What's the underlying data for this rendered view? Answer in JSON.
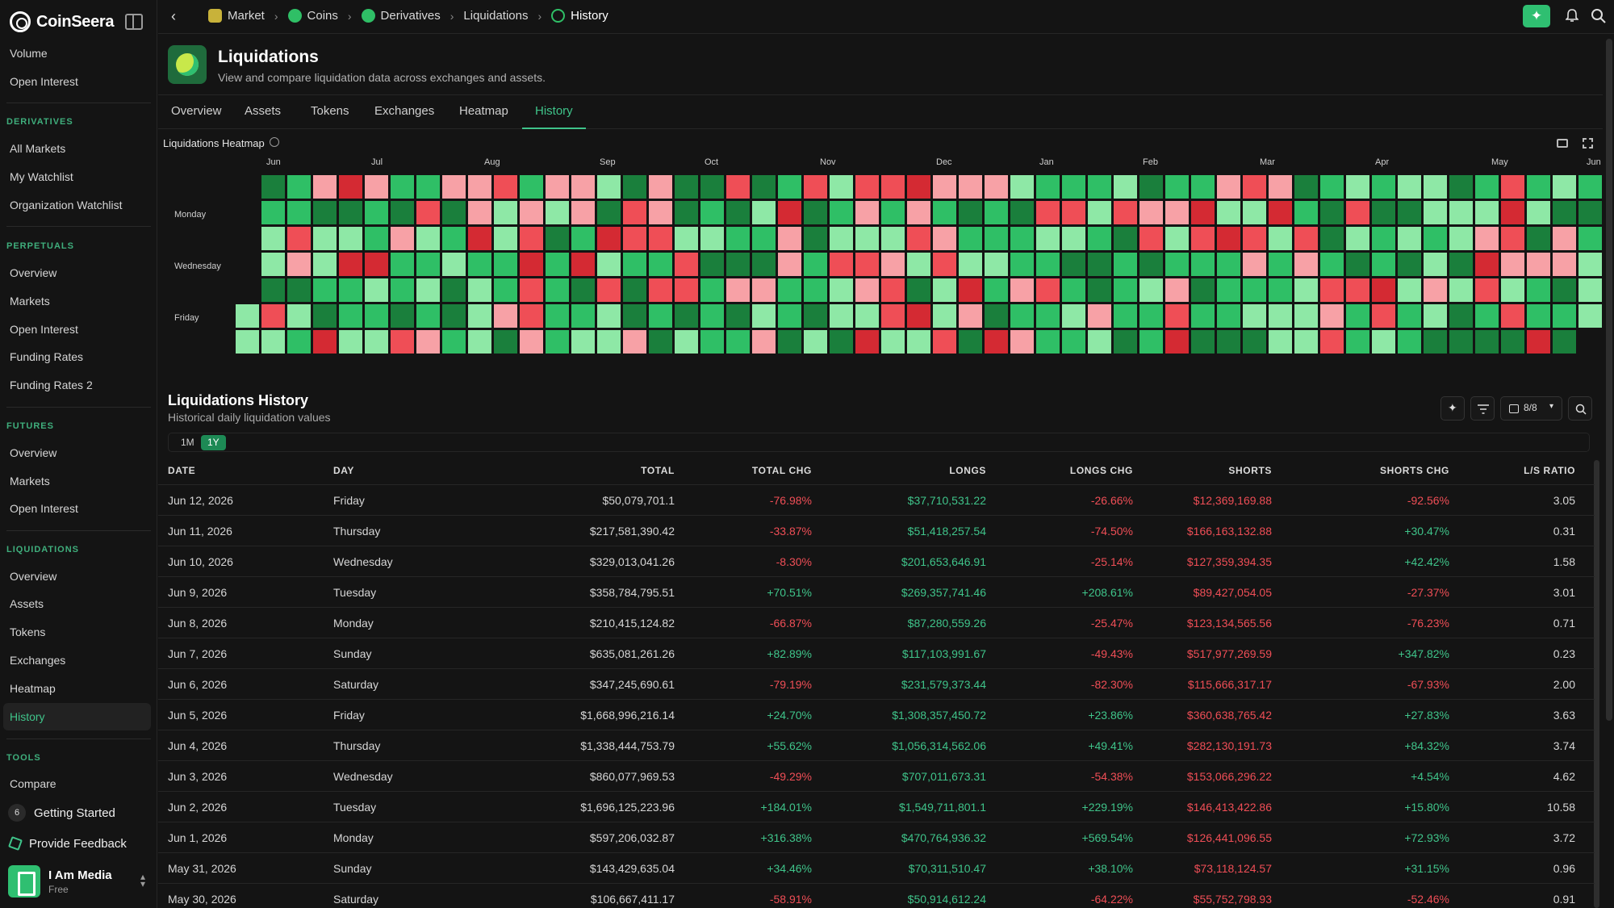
{
  "app": {
    "name": "CoinSeera"
  },
  "sidebar": {
    "top_items": [
      {
        "label": "Volume"
      },
      {
        "label": "Open Interest"
      }
    ],
    "sections": [
      {
        "title": "DERIVATIVES",
        "items": [
          {
            "label": "All Markets"
          },
          {
            "label": "My Watchlist"
          },
          {
            "label": "Organization Watchlist"
          }
        ]
      },
      {
        "title": "PERPETUALS",
        "items": [
          {
            "label": "Overview"
          },
          {
            "label": "Markets"
          },
          {
            "label": "Open Interest"
          },
          {
            "label": "Funding Rates"
          },
          {
            "label": "Funding Rates 2"
          }
        ]
      },
      {
        "title": "FUTURES",
        "items": [
          {
            "label": "Overview"
          },
          {
            "label": "Markets"
          },
          {
            "label": "Open Interest"
          }
        ]
      },
      {
        "title": "LIQUIDATIONS",
        "items": [
          {
            "label": "Overview"
          },
          {
            "label": "Assets"
          },
          {
            "label": "Tokens"
          },
          {
            "label": "Exchanges"
          },
          {
            "label": "Heatmap"
          },
          {
            "label": "History",
            "active": true
          }
        ]
      },
      {
        "title": "TOOLS",
        "items": [
          {
            "label": "Compare"
          }
        ]
      }
    ],
    "getting_started": {
      "label": "Getting Started",
      "badge": "6"
    },
    "feedback": {
      "label": "Provide Feedback"
    },
    "user": {
      "name": "I Am Media",
      "plan": "Free"
    }
  },
  "breadcrumbs": [
    {
      "label": "Market",
      "icon": "market-icon"
    },
    {
      "label": "Coins",
      "icon": "coins-icon"
    },
    {
      "label": "Derivatives",
      "icon": "derivatives-icon"
    },
    {
      "label": "Liquidations",
      "icon": ""
    },
    {
      "label": "History",
      "icon": "history-icon"
    }
  ],
  "page": {
    "title": "Liquidations",
    "subtitle": "View and compare liquidation data across exchanges and assets.",
    "tabs": [
      {
        "label": "Overview"
      },
      {
        "label": "Assets"
      },
      {
        "label": "Tokens"
      },
      {
        "label": "Exchanges"
      },
      {
        "label": "Heatmap"
      },
      {
        "label": "History",
        "active": true
      }
    ]
  },
  "heatmap": {
    "title": "Liquidations Heatmap",
    "months": [
      "Jun",
      "Jul",
      "Aug",
      "Sep",
      "Oct",
      "Nov",
      "Dec",
      "Jan",
      "Feb",
      "Mar",
      "Apr",
      "May",
      "Jun"
    ],
    "day_labels": [
      "Monday",
      "Wednesday",
      "Friday"
    ],
    "colors": {
      "strong_green": "#1a7f3c",
      "green": "#2fbf66",
      "light_green": "#8ee8a6",
      "light_red": "#f7a1a6",
      "red": "#ef4e56",
      "dark_red": "#d42a33"
    }
  },
  "history": {
    "title": "Liquidations History",
    "subtitle": "Historical daily liquidation values",
    "ranges": [
      {
        "label": "1M"
      },
      {
        "label": "1Y",
        "active": true
      }
    ],
    "columns_label": "8/8",
    "columns": [
      "DATE",
      "DAY",
      "TOTAL",
      "TOTAL CHG",
      "LONGS",
      "LONGS CHG",
      "SHORTS",
      "SHORTS CHG",
      "L/S RATIO"
    ],
    "rows": [
      {
        "date": "Jun 12, 2026",
        "day": "Friday",
        "total": "$50,079,701.1",
        "total_chg": "-76.98%",
        "longs": "$37,710,531.22",
        "longs_chg": "-26.66%",
        "shorts": "$12,369,169.88",
        "shorts_chg": "-92.56%",
        "ratio": "3.05"
      },
      {
        "date": "Jun 11, 2026",
        "day": "Thursday",
        "total": "$217,581,390.42",
        "total_chg": "-33.87%",
        "longs": "$51,418,257.54",
        "longs_chg": "-74.50%",
        "shorts": "$166,163,132.88",
        "shorts_chg": "+30.47%",
        "ratio": "0.31"
      },
      {
        "date": "Jun 10, 2026",
        "day": "Wednesday",
        "total": "$329,013,041.26",
        "total_chg": "-8.30%",
        "longs": "$201,653,646.91",
        "longs_chg": "-25.14%",
        "shorts": "$127,359,394.35",
        "shorts_chg": "+42.42%",
        "ratio": "1.58"
      },
      {
        "date": "Jun 9, 2026",
        "day": "Tuesday",
        "total": "$358,784,795.51",
        "total_chg": "+70.51%",
        "longs": "$269,357,741.46",
        "longs_chg": "+208.61%",
        "shorts": "$89,427,054.05",
        "shorts_chg": "-27.37%",
        "ratio": "3.01"
      },
      {
        "date": "Jun 8, 2026",
        "day": "Monday",
        "total": "$210,415,124.82",
        "total_chg": "-66.87%",
        "longs": "$87,280,559.26",
        "longs_chg": "-25.47%",
        "shorts": "$123,134,565.56",
        "shorts_chg": "-76.23%",
        "ratio": "0.71"
      },
      {
        "date": "Jun 7, 2026",
        "day": "Sunday",
        "total": "$635,081,261.26",
        "total_chg": "+82.89%",
        "longs": "$117,103,991.67",
        "longs_chg": "-49.43%",
        "shorts": "$517,977,269.59",
        "shorts_chg": "+347.82%",
        "ratio": "0.23"
      },
      {
        "date": "Jun 6, 2026",
        "day": "Saturday",
        "total": "$347,245,690.61",
        "total_chg": "-79.19%",
        "longs": "$231,579,373.44",
        "longs_chg": "-82.30%",
        "shorts": "$115,666,317.17",
        "shorts_chg": "-67.93%",
        "ratio": "2.00"
      },
      {
        "date": "Jun 5, 2026",
        "day": "Friday",
        "total": "$1,668,996,216.14",
        "total_chg": "+24.70%",
        "longs": "$1,308,357,450.72",
        "longs_chg": "+23.86%",
        "shorts": "$360,638,765.42",
        "shorts_chg": "+27.83%",
        "ratio": "3.63"
      },
      {
        "date": "Jun 4, 2026",
        "day": "Thursday",
        "total": "$1,338,444,753.79",
        "total_chg": "+55.62%",
        "longs": "$1,056,314,562.06",
        "longs_chg": "+49.41%",
        "shorts": "$282,130,191.73",
        "shorts_chg": "+84.32%",
        "ratio": "3.74"
      },
      {
        "date": "Jun 3, 2026",
        "day": "Wednesday",
        "total": "$860,077,969.53",
        "total_chg": "-49.29%",
        "longs": "$707,011,673.31",
        "longs_chg": "-54.38%",
        "shorts": "$153,066,296.22",
        "shorts_chg": "+4.54%",
        "ratio": "4.62"
      },
      {
        "date": "Jun 2, 2026",
        "day": "Tuesday",
        "total": "$1,696,125,223.96",
        "total_chg": "+184.01%",
        "longs": "$1,549,711,801.1",
        "longs_chg": "+229.19%",
        "shorts": "$146,413,422.86",
        "shorts_chg": "+15.80%",
        "ratio": "10.58"
      },
      {
        "date": "Jun 1, 2026",
        "day": "Monday",
        "total": "$597,206,032.87",
        "total_chg": "+316.38%",
        "longs": "$470,764,936.32",
        "longs_chg": "+569.54%",
        "shorts": "$126,441,096.55",
        "shorts_chg": "+72.93%",
        "ratio": "3.72"
      },
      {
        "date": "May 31, 2026",
        "day": "Sunday",
        "total": "$143,429,635.04",
        "total_chg": "+34.46%",
        "longs": "$70,311,510.47",
        "longs_chg": "+38.10%",
        "shorts": "$73,118,124.57",
        "shorts_chg": "+31.15%",
        "ratio": "0.96"
      },
      {
        "date": "May 30, 2026",
        "day": "Saturday",
        "total": "$106,667,411.17",
        "total_chg": "-58.91%",
        "longs": "$50,914,612.24",
        "longs_chg": "-64.22%",
        "shorts": "$55,752,798.93",
        "shorts_chg": "-52.46%",
        "ratio": "0.91"
      }
    ]
  }
}
